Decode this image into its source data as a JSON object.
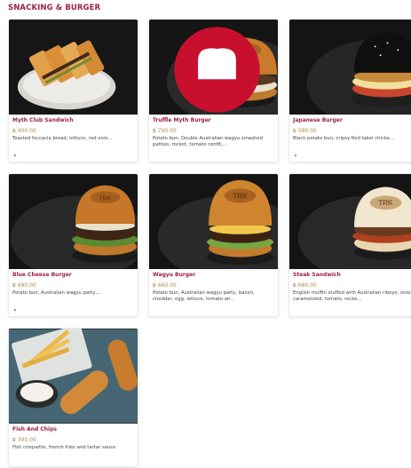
{
  "section": {
    "title": "SNACKING & BURGER"
  },
  "currency_symbol": "฿",
  "expand_glyph": "»",
  "items": [
    {
      "name": "Myth Club Sandwich",
      "price": "฿ 400.00",
      "description": "Toasted foccacia bread, lettuce, red onio...",
      "icon": "chevron-down-icon"
    },
    {
      "name": "Truffle Myth Burger",
      "price": "฿ 790.00",
      "description": "Potato bun, Double Australian wagyu smashed patties, rocket, tomato confit,...",
      "icon": "chef-badge-icon"
    },
    {
      "name": "Japanese Burger",
      "price": "฿ 580.00",
      "description": "Black potato bun, cripsy Red label chicke...",
      "icon": "chevron-down-icon"
    },
    {
      "name": "Blue Cheese Burger",
      "price": "฿ 680.00",
      "description": "Potato bun, Australian wagyu patty,...",
      "icon": "chevron-down-icon"
    },
    {
      "name": "Wagyu Burger",
      "price": "฿ 660.00",
      "description": "Potato bun, Australian wagyu patty, bacon, cheddar, egg, lettuce, tomato an..."
    },
    {
      "name": "Steak Sandwich",
      "price": "฿ 680.00",
      "description": "English muffin stuffed with Australian ribeye, onion caramelized, tomato, rocke..."
    },
    {
      "name": "Fish And Chips",
      "price": "฿ 390.00",
      "description": "Fish croquette, french fries and tartar sauce"
    }
  ]
}
